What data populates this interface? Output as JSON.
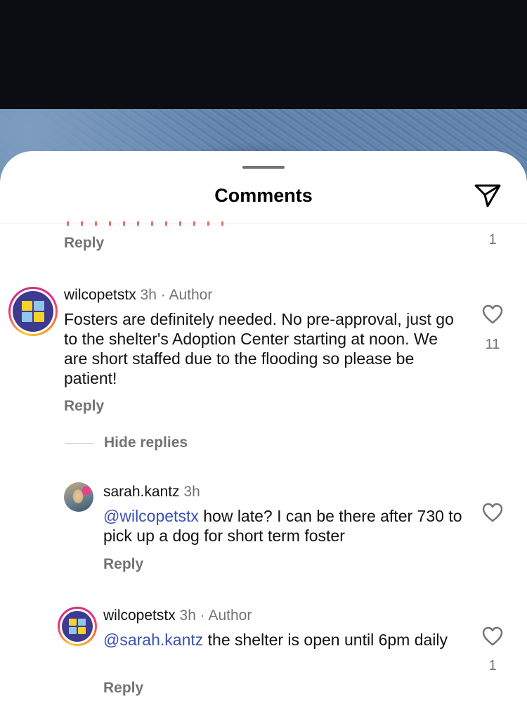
{
  "sheet": {
    "title": "Comments",
    "send_icon": "send-icon"
  },
  "top_item": {
    "reply_label": "Reply",
    "like_count": "1"
  },
  "comments": [
    {
      "username": "wilcopetstx",
      "time": "3h",
      "badge": "Author",
      "text": "Fosters are definitely needed. No pre-approval, just go to the shelter's Adoption Center starting at noon. We are short staffed due to the flooding so please be patient!",
      "like_count": "11",
      "reply_label": "Reply"
    }
  ],
  "hide_replies_label": "Hide replies",
  "replies": [
    {
      "username": "sarah.kantz",
      "time": "3h",
      "mention": "@wilcopetstx",
      "text": " how late? I can be there after 730 to pick up a dog for short term foster",
      "reply_label": "Reply"
    },
    {
      "username": "wilcopetstx",
      "time": "3h",
      "badge": "Author",
      "mention": "@sarah.kantz",
      "text": " the shelter is open until 6pm daily",
      "like_count": "1",
      "reply_label": "Reply"
    }
  ],
  "separator": "·",
  "colors": {
    "mention": "#3a4fb8",
    "muted": "#737373",
    "ring_gradient": [
      "#f9ce34",
      "#ee2a7b",
      "#c13584"
    ]
  }
}
